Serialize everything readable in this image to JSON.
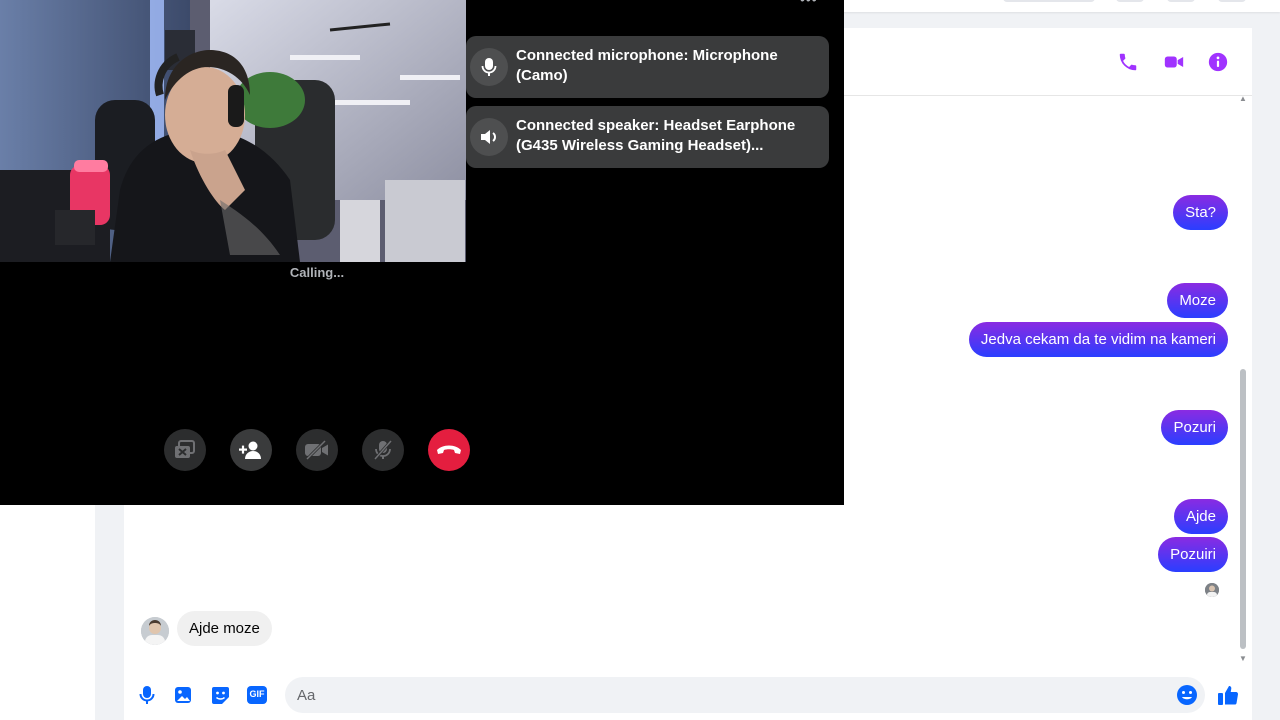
{
  "colors": {
    "accent": "#a033ff",
    "bubble_gradient_top": "#8a2be2",
    "bubble_gradient_bottom": "#2a3eff",
    "hangup": "#e41e3f"
  },
  "call": {
    "status": "Calling...",
    "notifications": [
      {
        "icon": "microphone-icon",
        "text": "Connected microphone: Microphone (Camo)"
      },
      {
        "icon": "speaker-icon",
        "text": "Connected speaker: Headset Earphone (G435 Wireless Gaming Headset)..."
      }
    ],
    "controls": [
      {
        "name": "share-screen-button",
        "icon": "screen-share-icon"
      },
      {
        "name": "add-person-button",
        "icon": "add-person-icon"
      },
      {
        "name": "video-toggle-button",
        "icon": "video-off-icon"
      },
      {
        "name": "mute-button",
        "icon": "mic-off-icon"
      },
      {
        "name": "end-call-button",
        "icon": "hangup-icon"
      }
    ]
  },
  "chat": {
    "header_icons": [
      "phone-icon",
      "video-camera-icon",
      "info-icon"
    ],
    "messages_out": [
      "Sta?",
      "Moze",
      "Jedva cekam da te vidim na kameri",
      "Pozuri",
      "Ajde",
      "Pozuiri"
    ],
    "message_in": "Ajde moze",
    "composer": {
      "placeholder": "Aa",
      "icons": [
        "microphone-icon",
        "image-icon",
        "sticker-icon",
        "gif-icon",
        "emoji-icon",
        "thumbs-up-icon"
      ],
      "gif_label": "GIF"
    }
  }
}
